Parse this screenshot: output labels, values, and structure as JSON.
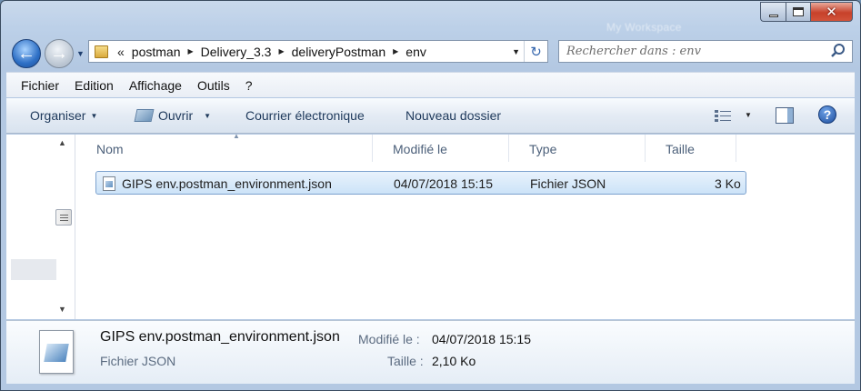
{
  "window": {
    "ghost_title": "My Workspace"
  },
  "nav": {
    "back_glyph": "←",
    "forward_glyph": "→",
    "breadcrumb_prefix": "«",
    "breadcrumbs": [
      "postman",
      "Delivery_3.3",
      "deliveryPostman",
      "env"
    ],
    "refresh_glyph": "↻"
  },
  "search": {
    "placeholder": "Rechercher dans : env"
  },
  "menubar": {
    "items": [
      "Fichier",
      "Edition",
      "Affichage",
      "Outils",
      "?"
    ]
  },
  "toolbar": {
    "organize": "Organiser",
    "open": "Ouvrir",
    "email": "Courrier électronique",
    "new_folder": "Nouveau dossier",
    "help": "?"
  },
  "columns": {
    "name": "Nom",
    "modified": "Modifié le",
    "type": "Type",
    "size": "Taille"
  },
  "files": [
    {
      "name": "GIPS env.postman_environment.json",
      "modified": "04/07/2018 15:15",
      "type": "Fichier JSON",
      "size": "3 Ko"
    }
  ],
  "details": {
    "name": "GIPS env.postman_environment.json",
    "type": "Fichier JSON",
    "modified_label": "Modifié le :",
    "modified_value": "04/07/2018 15:15",
    "size_label": "Taille :",
    "size_value": "2,10 Ko"
  },
  "colors": {
    "selection": "#cce3f8",
    "accent": "#2d6fc5",
    "close": "#c7412a"
  }
}
